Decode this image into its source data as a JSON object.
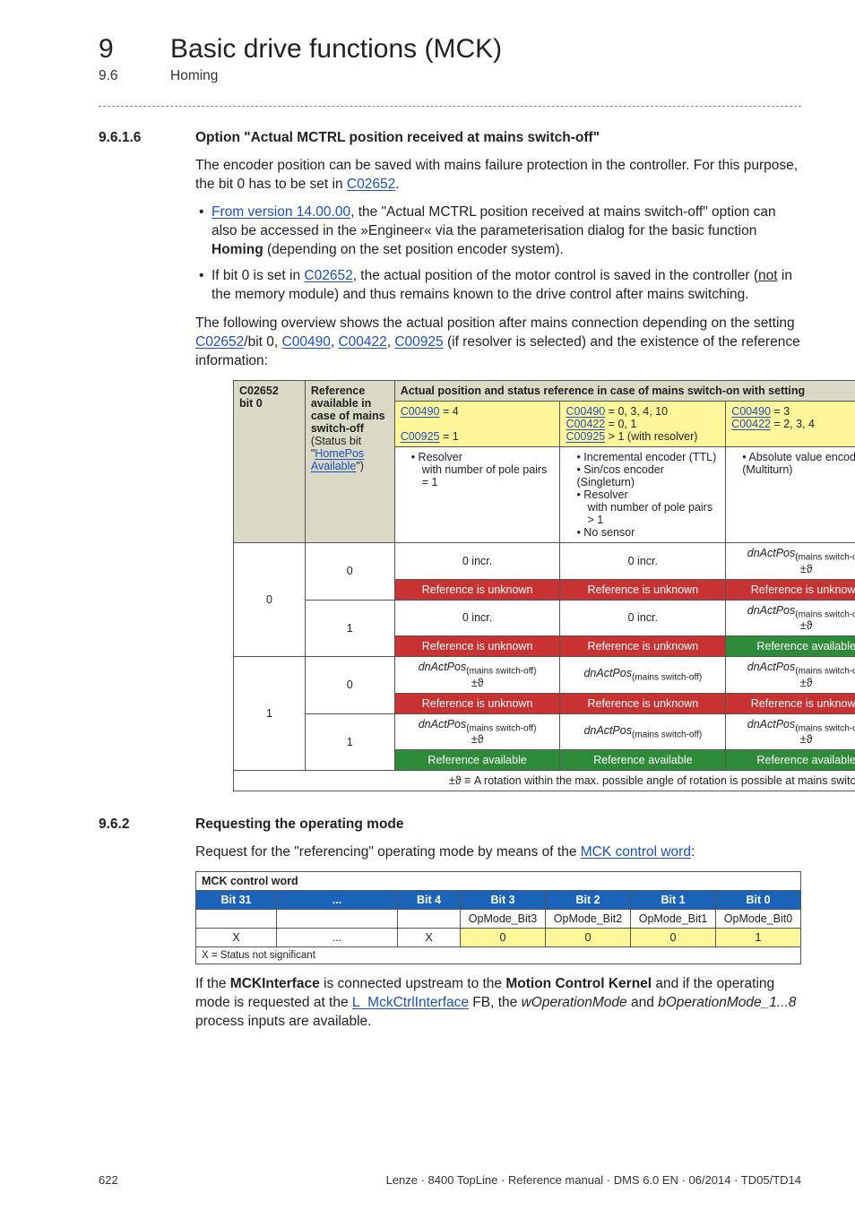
{
  "chapter": {
    "num": "9",
    "title": "Basic drive functions (MCK)"
  },
  "section": {
    "num": "9.6",
    "title": "Homing"
  },
  "s1": {
    "num": "9.6.1.6",
    "title": "Option \"Actual MCTRL position received at mains switch-off\"",
    "p1a": "The encoder position can be saved with mains failure protection in the controller. For this purpose, the bit 0 has to be set in ",
    "p1link": "C02652",
    "p1b": ".",
    "b1a": "From version 14.00.00",
    "b1b": ", the \"Actual MCTRL position received at mains switch-off\" option can also be accessed in the »Engineer« via the parameterisation dialog for the basic function ",
    "b1bold": "Homing",
    "b1c": " (depending on the set position encoder system).",
    "b2a": "If bit 0 is set in ",
    "b2link": "C02652",
    "b2b": ", the actual position of the motor control is saved in the controller (",
    "b2u": "not",
    "b2c": " in the memory module) and thus remains known to the drive control after mains switching.",
    "p2a": "The following overview shows the actual position after mains connection depending on the setting ",
    "p2l1": "C02652",
    "p2m1": "/bit 0, ",
    "p2l2": "C00490",
    "p2m2": ", ",
    "p2l3": "C00422",
    "p2m3": ", ",
    "p2l4": "C00925",
    "p2b": " (if resolver is selected) and the existence of  the reference information:"
  },
  "t1": {
    "h_c1a": "C02652",
    "h_c1b": "bit 0",
    "h_c2a": "Reference available in case of mains switch-off",
    "h_c2b": "(Status bit \"",
    "h_c2link1": "HomePos",
    "h_c2link2": "Available",
    "h_c2c": "\")",
    "h_span": "Actual position and status reference in case of mains switch-on with setting",
    "colA1": "C00490",
    "colA1v": " = 4",
    "colA2": "C00925",
    "colA2v": " = 1",
    "colB1": "C00490",
    "colB1v": " = 0, 3, 4, 10",
    "colB2": "C00422",
    "colB2v": " = 0, 1",
    "colB3": "C00925",
    "colB3v": " > 1 (with resolver)",
    "colC1": "C00490",
    "colC1v": " = 3",
    "colC2": "C00422",
    "colC2v": " = 2, 3, 4",
    "descA_l1": "Resolver",
    "descA_l2": "with number of pole pairs = 1",
    "descB_l1": "Incremental encoder (TTL)",
    "descB_l2": "Sin/cos encoder (Singleturn)",
    "descB_l3": "Resolver",
    "descB_l3b": "with number of pole pairs > 1",
    "descB_l4": "No sensor",
    "descC_l1": "Absolute value encoder (Multiturn)",
    "zero": "0",
    "one": "1",
    "zero_incr": "0 incr.",
    "dnA": "dnActPos",
    "dnSub": "(mains switch-off)",
    "pmtheta": "±ϑ",
    "ref_unknown": "Reference is unknown",
    "ref_avail": "Reference available",
    "footnote": "±ϑ ≡ A rotation within the max. possible angle of rotation is possible at mains switch-off."
  },
  "s2": {
    "num": "9.6.2",
    "title": "Requesting the operating mode",
    "p1a": "Request for the \"referencing\" operating mode by means of the ",
    "p1link": "MCK control word",
    "p1b": ":",
    "p2a": "If the ",
    "p2b1": "MCKInterface",
    "p2c": " is connected upstream to the ",
    "p2b2": "Motion Control Kernel",
    "p2d": " and if the operating mode is requested at the ",
    "p2link": "L_MckCtrlInterface",
    "p2e": " FB, the ",
    "p2i1": "wOperationMode",
    "p2f": " and ",
    "p2i2": "bOperationMode_1...8",
    "p2g": " process inputs are available."
  },
  "t2": {
    "caption": "MCK control word",
    "h_bit31": "Bit 31",
    "h_dots": "...",
    "h_bit4": "Bit 4",
    "h_bit3": "Bit 3",
    "h_bit2": "Bit 2",
    "h_bit1": "Bit 1",
    "h_bit0": "Bit 0",
    "r1_c4": "OpMode_Bit3",
    "r1_c5": "OpMode_Bit2",
    "r1_c6": "OpMode_Bit1",
    "r1_c7": "OpMode_Bit0",
    "r2_c1": "X",
    "r2_c2": "...",
    "r2_c3": "X",
    "r2_c4": "0",
    "r2_c5": "0",
    "r2_c6": "0",
    "r2_c7": "1",
    "foot": "X = Status not significant"
  },
  "footer": {
    "page": "622",
    "right": "Lenze · 8400 TopLine · Reference manual · DMS 6.0 EN · 06/2014 · TD05/TD14"
  }
}
